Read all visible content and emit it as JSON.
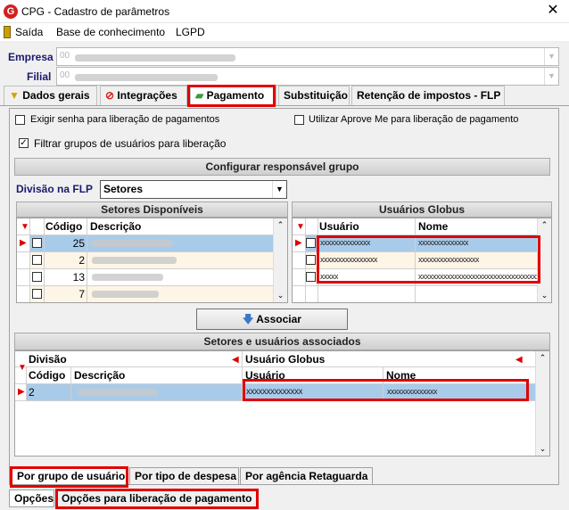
{
  "window": {
    "title": "CPG - Cadastro de parâmetros",
    "logo": "G",
    "close": "✕"
  },
  "menu": {
    "items": [
      "Saída",
      "Base de conhecimento",
      "LGPD"
    ]
  },
  "fields": {
    "empresa_label": "Empresa",
    "empresa_value": "00",
    "filial_label": "Filial",
    "filial_value": "00"
  },
  "tabs": [
    "Dados gerais",
    "Integrações",
    "Pagamento",
    "Substituição",
    "Retenção de impostos - FLP"
  ],
  "pagamento": {
    "chk_senha": "Exigir senha para liberação de pagamentos",
    "chk_aprove": "Utilizar Aprove Me para liberação de pagamento",
    "chk_filtrar": "Filtrar grupos de usuários para liberação",
    "configurar_header": "Configurar responsável grupo",
    "divisao_label": "Divisão na FLP",
    "divisao_value": "Setores",
    "setores_header": "Setores Disponíveis",
    "setores_cols": [
      "Código",
      "Descrição"
    ],
    "setores_rows": [
      {
        "codigo": "25",
        "descricao": ""
      },
      {
        "codigo": "2",
        "descricao": ""
      },
      {
        "codigo": "13",
        "descricao": ""
      },
      {
        "codigo": "7",
        "descricao": ""
      }
    ],
    "usuarios_header": "Usuários Globus",
    "usuarios_cols": [
      "Usuário",
      "Nome"
    ],
    "usuarios_rows": [
      {
        "usuario": "xxxxxxxxxxxxxx",
        "nome": "xxxxxxxxxxxxxx"
      },
      {
        "usuario": "xxxxxxxxxxxxxxxx",
        "nome": "xxxxxxxxxxxxxxxxx"
      },
      {
        "usuario": "xxxxx",
        "nome": "xxxxxxxxxxxxxxxxxxxxxxxxxxxxxxxxxxxx"
      }
    ],
    "associar_label": "Associar",
    "associados_header": "Setores e usuários associados",
    "assoc_group_divisao": "Divisão",
    "assoc_group_usuario": "Usuário Globus",
    "assoc_cols": [
      "Código",
      "Descrição",
      "Usuário",
      "Nome"
    ],
    "assoc_rows": [
      {
        "codigo": "2",
        "descricao": "",
        "usuario": "xxxxxxxxxxxxxx",
        "nome": "xxxxxxxxxxxxxx"
      }
    ]
  },
  "sub_tabs": [
    "Por grupo de usuário",
    "Por tipo de despesa",
    "Por agência Retaguarda"
  ],
  "bottom_tabs": [
    "Opções",
    "Opções para liberação de pagamento"
  ],
  "colors": {
    "highlight": "#e00000",
    "selected_row": "#a8cbea"
  }
}
